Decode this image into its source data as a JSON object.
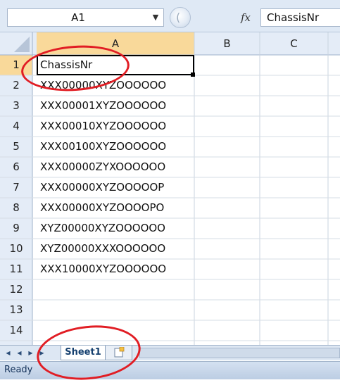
{
  "formula_bar": {
    "name_box": "A1",
    "fx_label": "fx",
    "formula_value": "ChassisNr"
  },
  "columns": [
    "A",
    "B",
    "C"
  ],
  "rows": [
    {
      "num": "1",
      "a": "ChassisNr"
    },
    {
      "num": "2",
      "a": "XXX00000XYZOOOOOO"
    },
    {
      "num": "3",
      "a": "XXX00001XYZOOOOOO"
    },
    {
      "num": "4",
      "a": "XXX00010XYZOOOOOO"
    },
    {
      "num": "5",
      "a": "XXX00100XYZOOOOOO"
    },
    {
      "num": "6",
      "a": "XXX00000ZYXOOOOOO"
    },
    {
      "num": "7",
      "a": "XXX00000XYZOOOOOP"
    },
    {
      "num": "8",
      "a": "XXX00000XYZOOOOPO"
    },
    {
      "num": "9",
      "a": "XYZ00000XYZOOOOOO"
    },
    {
      "num": "10",
      "a": "XYZ00000XXXOOOOOO"
    },
    {
      "num": "11",
      "a": "XXX10000XYZOOOOOO"
    },
    {
      "num": "12",
      "a": ""
    },
    {
      "num": "13",
      "a": ""
    },
    {
      "num": "14",
      "a": ""
    }
  ],
  "selected_cell": "A1",
  "sheet_tabs": {
    "tabs": [
      "Sheet1"
    ],
    "active": "Sheet1",
    "nav_icons": [
      "first-sheet-icon",
      "prev-sheet-icon",
      "next-sheet-icon",
      "last-sheet-icon"
    ],
    "insert_icon": "insert-sheet-icon"
  },
  "status_bar": {
    "text": "Ready"
  },
  "colors": {
    "header_bg": "#e4ecf7",
    "selected_header_bg": "#f9d99a",
    "annotation": "#e11d24"
  }
}
